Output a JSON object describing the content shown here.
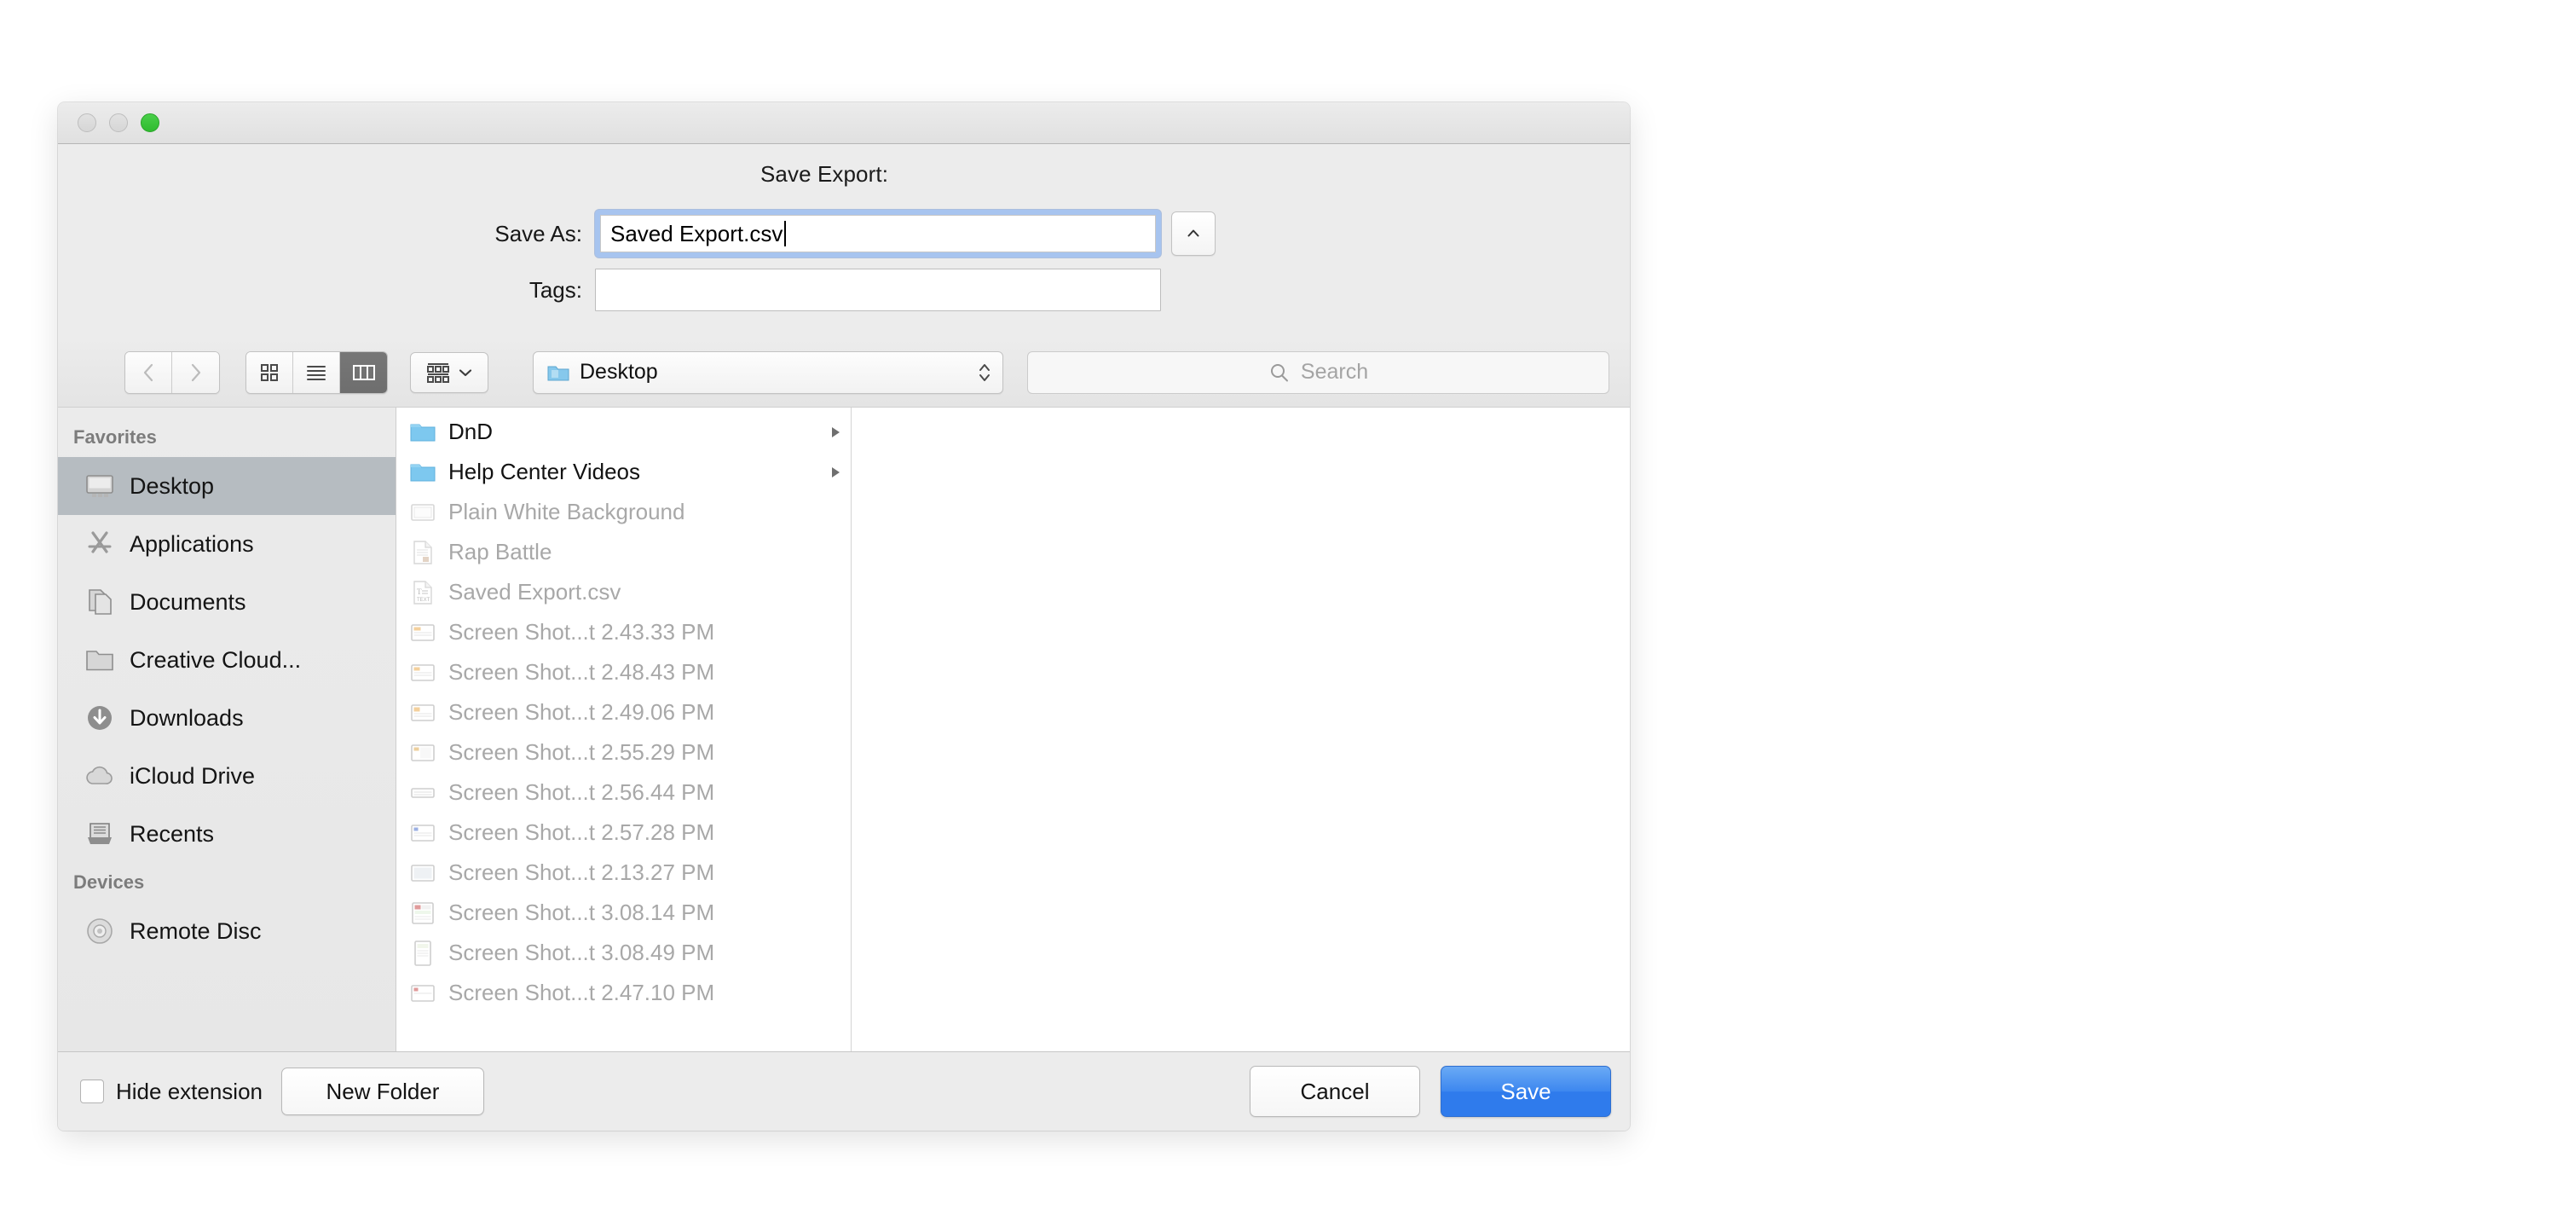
{
  "window": {
    "traffic_lights": {
      "close": "close-button",
      "minimize": "minimize-button",
      "zoom": "zoom-button"
    }
  },
  "dialog": {
    "title": "Save Export:",
    "save_as_label": "Save As:",
    "save_as_value": "Saved Export.csv",
    "tags_label": "Tags:",
    "tags_value": "",
    "disclosure_icon": "chevron-up-icon"
  },
  "toolbar": {
    "back_icon": "chevron-left-icon",
    "forward_icon": "chevron-right-icon",
    "icon_view": "grid-view-icon",
    "list_view": "list-view-icon",
    "column_view": "column-view-icon",
    "active_view": "column-view-icon",
    "group_icon": "group-items-icon",
    "group_chevron": "chevron-down-icon",
    "path": {
      "folder_icon": "folder-icon",
      "label": "Desktop",
      "stepper_icon": "up-down-stepper-icon"
    },
    "search": {
      "icon": "search-icon",
      "placeholder": "Search",
      "value": ""
    }
  },
  "sidebar": {
    "sections": [
      {
        "header": "Favorites",
        "items": [
          {
            "label": "Desktop",
            "icon": "desktop-icon",
            "selected": true
          },
          {
            "label": "Applications",
            "icon": "applications-icon",
            "selected": false
          },
          {
            "label": "Documents",
            "icon": "documents-icon",
            "selected": false
          },
          {
            "label": "Creative Cloud...",
            "icon": "folder-icon",
            "selected": false
          },
          {
            "label": "Downloads",
            "icon": "downloads-icon",
            "selected": false
          },
          {
            "label": "iCloud Drive",
            "icon": "cloud-icon",
            "selected": false
          },
          {
            "label": "Recents",
            "icon": "recents-tray-icon",
            "selected": false
          }
        ]
      },
      {
        "header": "Devices",
        "items": [
          {
            "label": "Remote Disc",
            "icon": "optical-disc-icon",
            "selected": false
          }
        ]
      }
    ]
  },
  "file_list": [
    {
      "name": "DnD",
      "icon": "folder-icon",
      "kind": "folder",
      "disabled": false,
      "disclosure": true
    },
    {
      "name": "Help Center Videos",
      "icon": "folder-icon",
      "kind": "folder",
      "disabled": false,
      "disclosure": true
    },
    {
      "name": "Plain White Background",
      "icon": "image-file-icon",
      "kind": "file",
      "disabled": true,
      "disclosure": false
    },
    {
      "name": "Rap Battle",
      "icon": "document-file-icon",
      "kind": "file",
      "disabled": true,
      "disclosure": false
    },
    {
      "name": "Saved Export.csv",
      "icon": "text-file-icon",
      "kind": "file",
      "disabled": true,
      "disclosure": false
    },
    {
      "name": "Screen Shot...t 2.43.33 PM",
      "icon": "screenshot-file-icon",
      "kind": "file",
      "disabled": true,
      "disclosure": false
    },
    {
      "name": "Screen Shot...t 2.48.43 PM",
      "icon": "screenshot-file-icon",
      "kind": "file",
      "disabled": true,
      "disclosure": false
    },
    {
      "name": "Screen Shot...t 2.49.06 PM",
      "icon": "screenshot-file-icon",
      "kind": "file",
      "disabled": true,
      "disclosure": false
    },
    {
      "name": "Screen Shot...t 2.55.29 PM",
      "icon": "screenshot-file-icon",
      "kind": "file",
      "disabled": true,
      "disclosure": false
    },
    {
      "name": "Screen Shot...t 2.56.44 PM",
      "icon": "screenshot-file-icon",
      "kind": "file",
      "disabled": true,
      "disclosure": false
    },
    {
      "name": "Screen Shot...t 2.57.28 PM",
      "icon": "screenshot-file-icon",
      "kind": "file",
      "disabled": true,
      "disclosure": false
    },
    {
      "name": "Screen Shot...t 2.13.27 PM",
      "icon": "screenshot-file-icon",
      "kind": "file",
      "disabled": true,
      "disclosure": false
    },
    {
      "name": "Screen Shot...t 3.08.14 PM",
      "icon": "screenshot-file-icon",
      "kind": "file",
      "disabled": true,
      "disclosure": false
    },
    {
      "name": "Screen Shot...t 3.08.49 PM",
      "icon": "screenshot-file-icon",
      "kind": "file",
      "disabled": true,
      "disclosure": false
    },
    {
      "name": "Screen Shot...t 2.47.10 PM",
      "icon": "screenshot-file-icon",
      "kind": "file",
      "disabled": true,
      "disclosure": false
    }
  ],
  "bottom_bar": {
    "hide_extension_label": "Hide extension",
    "hide_extension_checked": false,
    "new_folder_label": "New Folder",
    "cancel_label": "Cancel",
    "save_label": "Save"
  },
  "colors": {
    "accent_blue": "#2f7bec",
    "focus_ring": "#a7c4ef",
    "selection_gray": "#b6bcc1",
    "folder_blue": "#7dc8ef",
    "window_bg": "#ececec",
    "zoom_green": "#3cc13c"
  }
}
